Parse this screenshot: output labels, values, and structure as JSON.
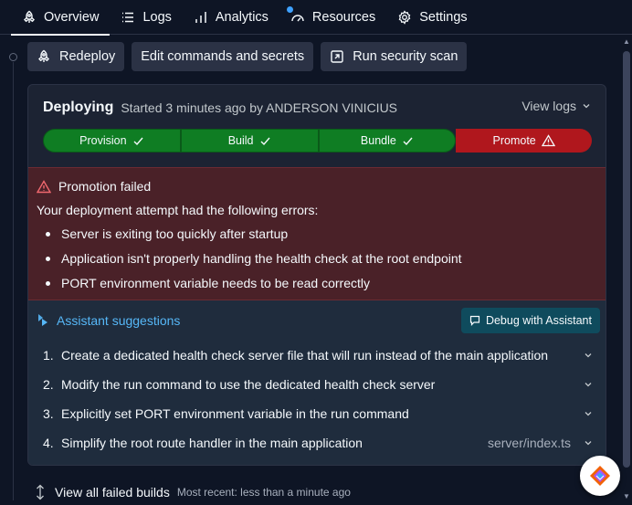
{
  "tabs": [
    {
      "label": "Overview",
      "icon": "rocket-icon",
      "active": true
    },
    {
      "label": "Logs",
      "icon": "list-icon"
    },
    {
      "label": "Analytics",
      "icon": "bar-chart-icon",
      "badge": true
    },
    {
      "label": "Resources",
      "icon": "gauge-icon"
    },
    {
      "label": "Settings",
      "icon": "gear-icon"
    }
  ],
  "actions": {
    "redeploy": "Redeploy",
    "edit": "Edit commands and secrets",
    "scan": "Run security scan"
  },
  "deployment": {
    "status": "Deploying",
    "subtitle": "Started 3 minutes ago by ANDERSON VINICIUS",
    "view_logs": "View logs",
    "stages": [
      {
        "label": "Provision",
        "state": "success"
      },
      {
        "label": "Build",
        "state": "success"
      },
      {
        "label": "Bundle",
        "state": "success"
      },
      {
        "label": "Promote",
        "state": "failed"
      }
    ]
  },
  "error": {
    "title": "Promotion failed",
    "intro": "Your deployment attempt had the following errors:",
    "items": [
      "Server is exiting too quickly after startup",
      "Application isn't properly handling the health check at the root endpoint",
      "PORT environment variable needs to be read correctly"
    ]
  },
  "assistant": {
    "title": "Assistant suggestions",
    "debug_button": "Debug with Assistant",
    "steps": [
      {
        "num": "1.",
        "text": "Create a dedicated health check server file that will run instead of the main application",
        "file": ""
      },
      {
        "num": "2.",
        "text": "Modify the run command to use the dedicated health check server",
        "file": ""
      },
      {
        "num": "3.",
        "text": "Explicitly set PORT environment variable in the run command",
        "file": ""
      },
      {
        "num": "4.",
        "text": "Simplify the root route handler in the main application",
        "file": "server/index.ts"
      }
    ]
  },
  "failed_builds": {
    "label": "View all failed builds",
    "recent": "Most recent: less than a minute ago"
  },
  "colors": {
    "background": "#0e1525",
    "card": "#1c2333",
    "success": "#0f7d23",
    "failed": "#b0171d",
    "error_bg": "#4a2128",
    "assistant_accent": "#56b7f7"
  }
}
